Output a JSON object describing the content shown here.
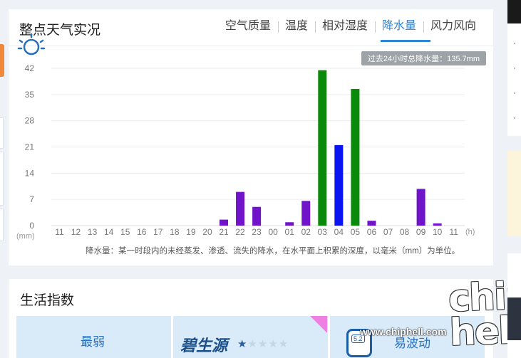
{
  "weather": {
    "title": "整点天气实况",
    "tabs": [
      {
        "label": "空气质量",
        "active": false
      },
      {
        "label": "温度",
        "active": false
      },
      {
        "label": "相对湿度",
        "active": false
      },
      {
        "label": "降水量",
        "active": true
      },
      {
        "label": "风力风向",
        "active": false
      }
    ],
    "total_badge": "过去24小时总降水量：135.7mm",
    "footnote": "降水量：某一时段内的未经蒸发、渗透、流失的降水，在水平面上积累的深度，以毫米（mm）为单位。"
  },
  "chart_data": {
    "type": "bar",
    "categories": [
      "11",
      "12",
      "13",
      "14",
      "15",
      "16",
      "17",
      "18",
      "19",
      "20",
      "21",
      "22",
      "23",
      "00",
      "01",
      "02",
      "03",
      "04",
      "05",
      "06",
      "07",
      "08",
      "09",
      "10",
      "11"
    ],
    "values": [
      0,
      0,
      0,
      0,
      0,
      0,
      0,
      0,
      0,
      0,
      1.6,
      9.0,
      5.0,
      0,
      0.9,
      6.6,
      41.5,
      21.5,
      36.5,
      1.3,
      0,
      0,
      9.8,
      0.6,
      0
    ],
    "bar_colors": [
      "#6f14c9",
      "#6f14c9",
      "#6f14c9",
      "#6f14c9",
      "#6f14c9",
      "#6f14c9",
      "#6f14c9",
      "#6f14c9",
      "#6f14c9",
      "#6f14c9",
      "#6f14c9",
      "#6f14c9",
      "#6f14c9",
      "#6f14c9",
      "#6f14c9",
      "#6f14c9",
      "#0a8a0a",
      "#0a14f0",
      "#0a8a0a",
      "#6f14c9",
      "#6f14c9",
      "#6f14c9",
      "#6f14c9",
      "#6f14c9",
      "#6f14c9"
    ],
    "y_ticks": [
      0,
      7,
      14,
      21,
      28,
      35,
      42
    ],
    "ylim": [
      0,
      42
    ],
    "ylabel": "(mm)",
    "xlabel": "(h)",
    "grid": true
  },
  "life": {
    "title": "生活指数",
    "items": [
      {
        "label": "最弱",
        "icon": "sun-icon"
      },
      {
        "label": "碧生源",
        "icon": "brand-logo",
        "rating": 1,
        "max_rating": 5
      },
      {
        "label": "易波动",
        "icon": "blood-pressure-meter-icon",
        "meter_text": "5.2"
      }
    ]
  },
  "watermark": {
    "url": "www.chiphell.com",
    "logo": "chip hell"
  },
  "right_column": {
    "bullets": [
      "·",
      "·",
      "·",
      "·"
    ]
  },
  "colors": {
    "accent": "#2e85d6",
    "orange": "#f0883a",
    "purple_bar": "#6f14c9",
    "green_bar": "#0a8a0a",
    "blue_bar": "#0a14f0"
  }
}
